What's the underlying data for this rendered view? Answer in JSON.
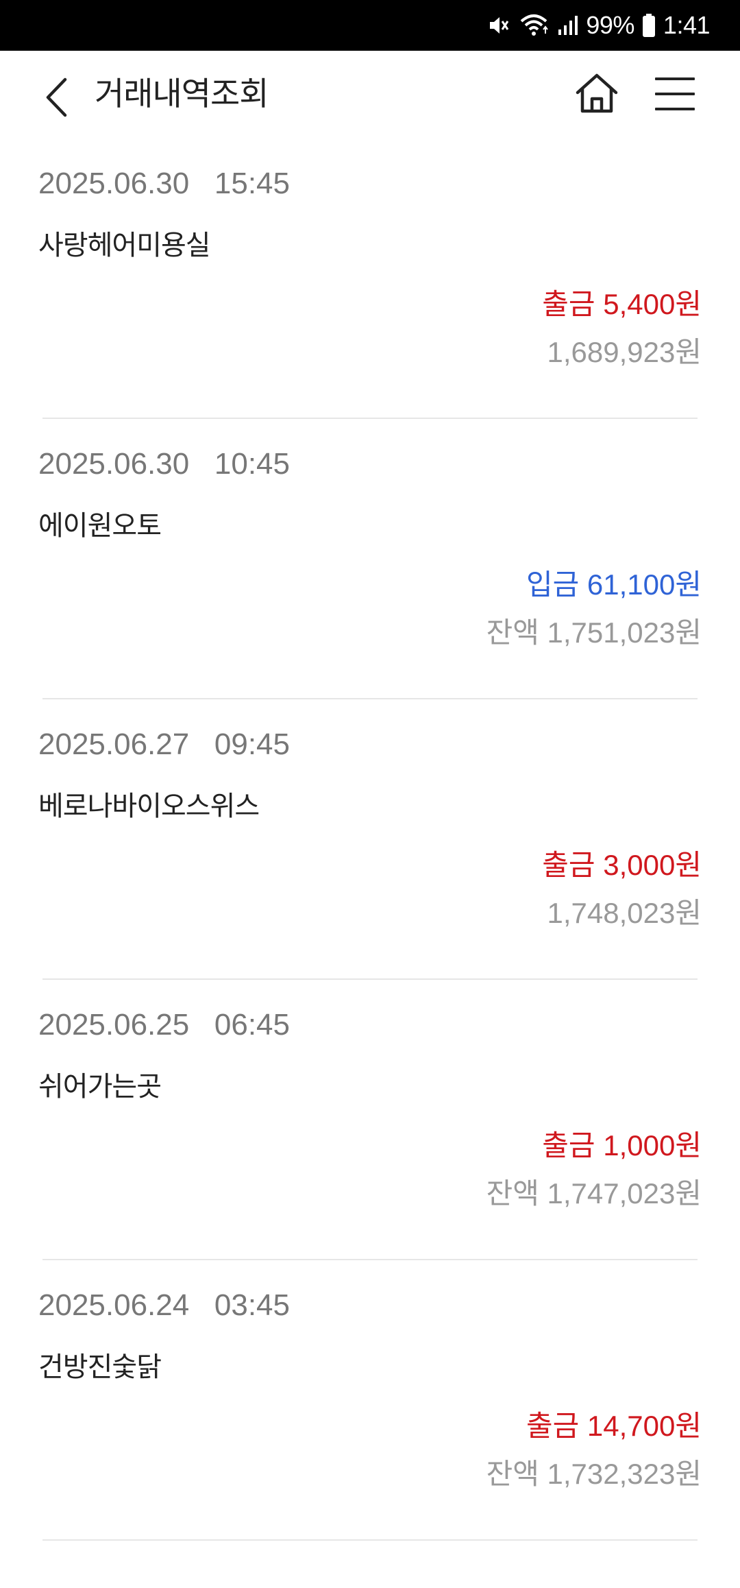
{
  "status_bar": {
    "battery": "99%",
    "time": "1:41",
    "icons": [
      "mute-vibrate-icon",
      "wifi-icon",
      "signal-icon",
      "battery-icon"
    ]
  },
  "header": {
    "title": "거래내역조회",
    "icons": [
      "back-chevron-icon",
      "home-icon",
      "hamburger-menu-icon"
    ]
  },
  "transactions": [
    {
      "datetime": "2025.06.30   15:45",
      "merchant": "사랑헤어미용실",
      "amount": "출금 5,400원",
      "type": "withdrawal",
      "balance": "1,689,923원"
    },
    {
      "datetime": "2025.06.30   10:45",
      "merchant": "에이원오토",
      "amount": "입금 61,100원",
      "type": "deposit",
      "balance": "잔액 1,751,023원"
    },
    {
      "datetime": "2025.06.27   09:45",
      "merchant": "베로나바이오스위스",
      "amount": "출금 3,000원",
      "type": "withdrawal",
      "balance": "1,748,023원"
    },
    {
      "datetime": "2025.06.25   06:45",
      "merchant": "쉬어가는곳",
      "amount": "출금 1,000원",
      "type": "withdrawal",
      "balance": "잔액 1,747,023원"
    },
    {
      "datetime": "2025.06.24   03:45",
      "merchant": "건방진숯닭",
      "amount": "출금 14,700원",
      "type": "withdrawal",
      "balance": "잔액 1,732,323원"
    }
  ],
  "colors": {
    "withdrawal": "#d0181e",
    "deposit": "#2f63d6",
    "balance": "#999999",
    "datetime": "#777777"
  }
}
